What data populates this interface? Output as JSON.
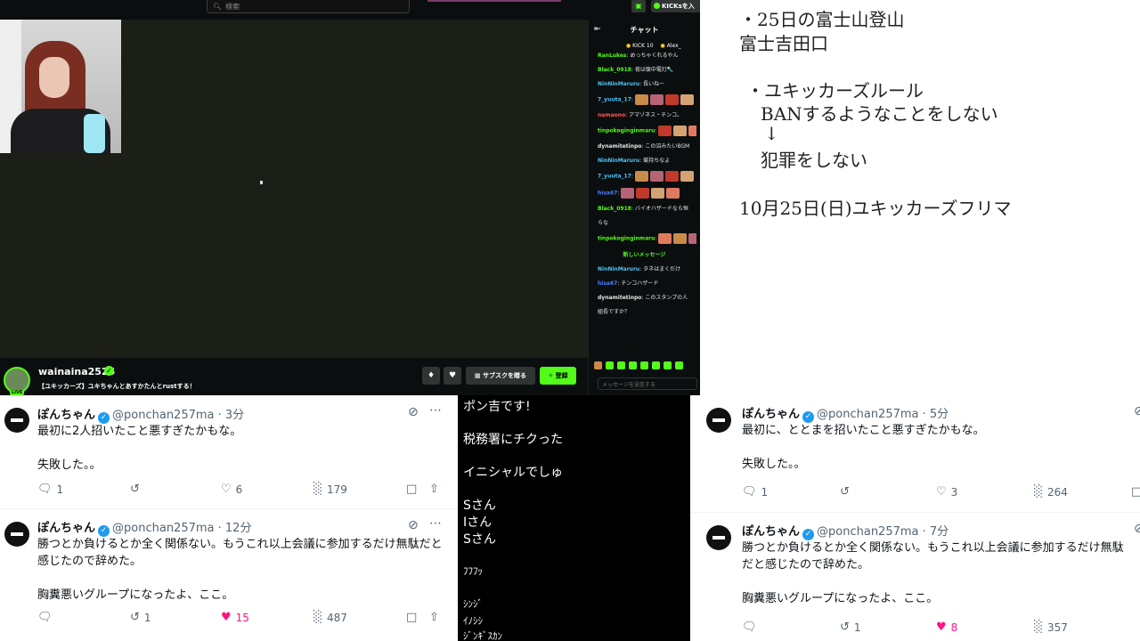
{
  "stream": {
    "search_placeholder": "検索",
    "kicks_label": "KICKsを入",
    "streamer_name": "wainaina2525",
    "stream_title": "【ユキッカーズ】ユキちゃんとあすかたんとrustする！",
    "subscribe_label": "サブスクを贈る",
    "follow_label": "登録",
    "live_label": "LIVE"
  },
  "chat": {
    "title": "チャット",
    "pins": [
      {
        "label": "KICK 10"
      },
      {
        "label": "Alex_"
      }
    ],
    "messages": [
      {
        "user": "RanLukes",
        "text": "めっちゃくれるやん",
        "color": "#53fc18"
      },
      {
        "user": "Black_0918",
        "text": "夜は懐中電灯🔦",
        "color": "#53fc18"
      },
      {
        "user": "NinNinMaruru",
        "text": "長いねー",
        "color": "#4fc3f7"
      },
      {
        "user": "7_yuuta_17",
        "text": "",
        "color": "#4fc3f7"
      },
      {
        "user": "namaono",
        "text": "アマゾネス・チンコ。",
        "color": "#ff5a5a"
      },
      {
        "user": "tinpokoginginmaru",
        "text": "",
        "color": "#53fc18"
      },
      {
        "user": "dynamitetinpo",
        "text": "この沼みたいBGM",
        "color": "#e6e6e6"
      },
      {
        "user": "NinNinMaruru",
        "text": "競持ちなよ",
        "color": "#4fc3f7"
      },
      {
        "user": "7_yuuta_17",
        "text": "",
        "color": "#4fc3f7"
      },
      {
        "user": "hisa67",
        "text": "",
        "color": "#4a7fff"
      },
      {
        "user": "Black_0918",
        "text": "バイオハザードなら恒",
        "color": "#53fc18"
      },
      {
        "user": "",
        "text": "らな",
        "color": "#e6e6e6"
      },
      {
        "user": "tinpokoginginmaru",
        "text": "",
        "color": "#53fc18"
      },
      {
        "user": "NinNinMaruru",
        "text": "タネはまくだけ",
        "color": "#4fc3f7"
      },
      {
        "user": "hisa67",
        "text": "チンコハザード",
        "color": "#4a7fff"
      },
      {
        "user": "dynamitetinpo",
        "text": "このスタンプの人",
        "color": "#e6e6e6"
      },
      {
        "user": "",
        "text": "組長ですか？",
        "color": "#e6e6e6"
      }
    ],
    "new_messages_divider": "新しいメッセージ",
    "input_placeholder": "メッセージを送信する"
  },
  "notes": {
    "lines": [
      "・25日の富士山登山",
      "富士吉田口",
      "・ユキッカーズルール",
      "BANするようなことをしない",
      "↓",
      "犯罪をしない",
      "10月25日(日)ユキッカーズフリマ"
    ]
  },
  "tweets_left": [
    {
      "name": "ぽんちゃん",
      "handle": "@ponchan257ma",
      "time": "3分",
      "body": "最初に2人招いたこと悪すぎたかもな。\n\n失敗した。。",
      "replies": "1",
      "retweets": "",
      "likes": "6",
      "views": "179",
      "liked": false
    },
    {
      "name": "ぽんちゃん",
      "handle": "@ponchan257ma",
      "time": "12分",
      "body": "勝つとか負けるとか全く関係ない。もうこれ以上会議に参加するだけ無駄だと感じたので辞めた。\n\n胸糞悪いグループになったよ、ここ。",
      "replies": "",
      "retweets": "1",
      "likes": "15",
      "views": "487",
      "liked": true
    }
  ],
  "tweets_right": [
    {
      "name": "ぽんちゃん",
      "handle": "@ponchan257ma",
      "time": "5分",
      "body": "最初に、ととまを招いたこと悪すぎたかもな。\n\n失敗した。。",
      "replies": "1",
      "retweets": "",
      "likes": "3",
      "views": "264",
      "liked": false
    },
    {
      "name": "ぽんちゃん",
      "handle": "@ponchan257ma",
      "time": "7分",
      "body": "勝つとか負けるとか全く関係ない。もうこれ以上会議に参加するだけ無駄だと感じたので辞めた。\n\n胸糞悪いグループになったよ、ここ。",
      "replies": "",
      "retweets": "1",
      "likes": "8",
      "views": "357",
      "liked": true
    }
  ],
  "middle": {
    "lines": [
      "ポン吉です!",
      "税務署にチクった",
      "イニシャルでしゅ",
      "Sさん",
      "Iさん",
      "Sさん",
      "ﾌﾌﾌｯ",
      "ｼﾝｼﾞ",
      "ｲﾉｼｼ",
      "ｼﾞﾝｷﾞｽｶﾝ"
    ]
  },
  "colors": {
    "kick_green": "#53fc18",
    "twitter_blue": "#1d9bf0",
    "like_pink": "#f91880"
  }
}
